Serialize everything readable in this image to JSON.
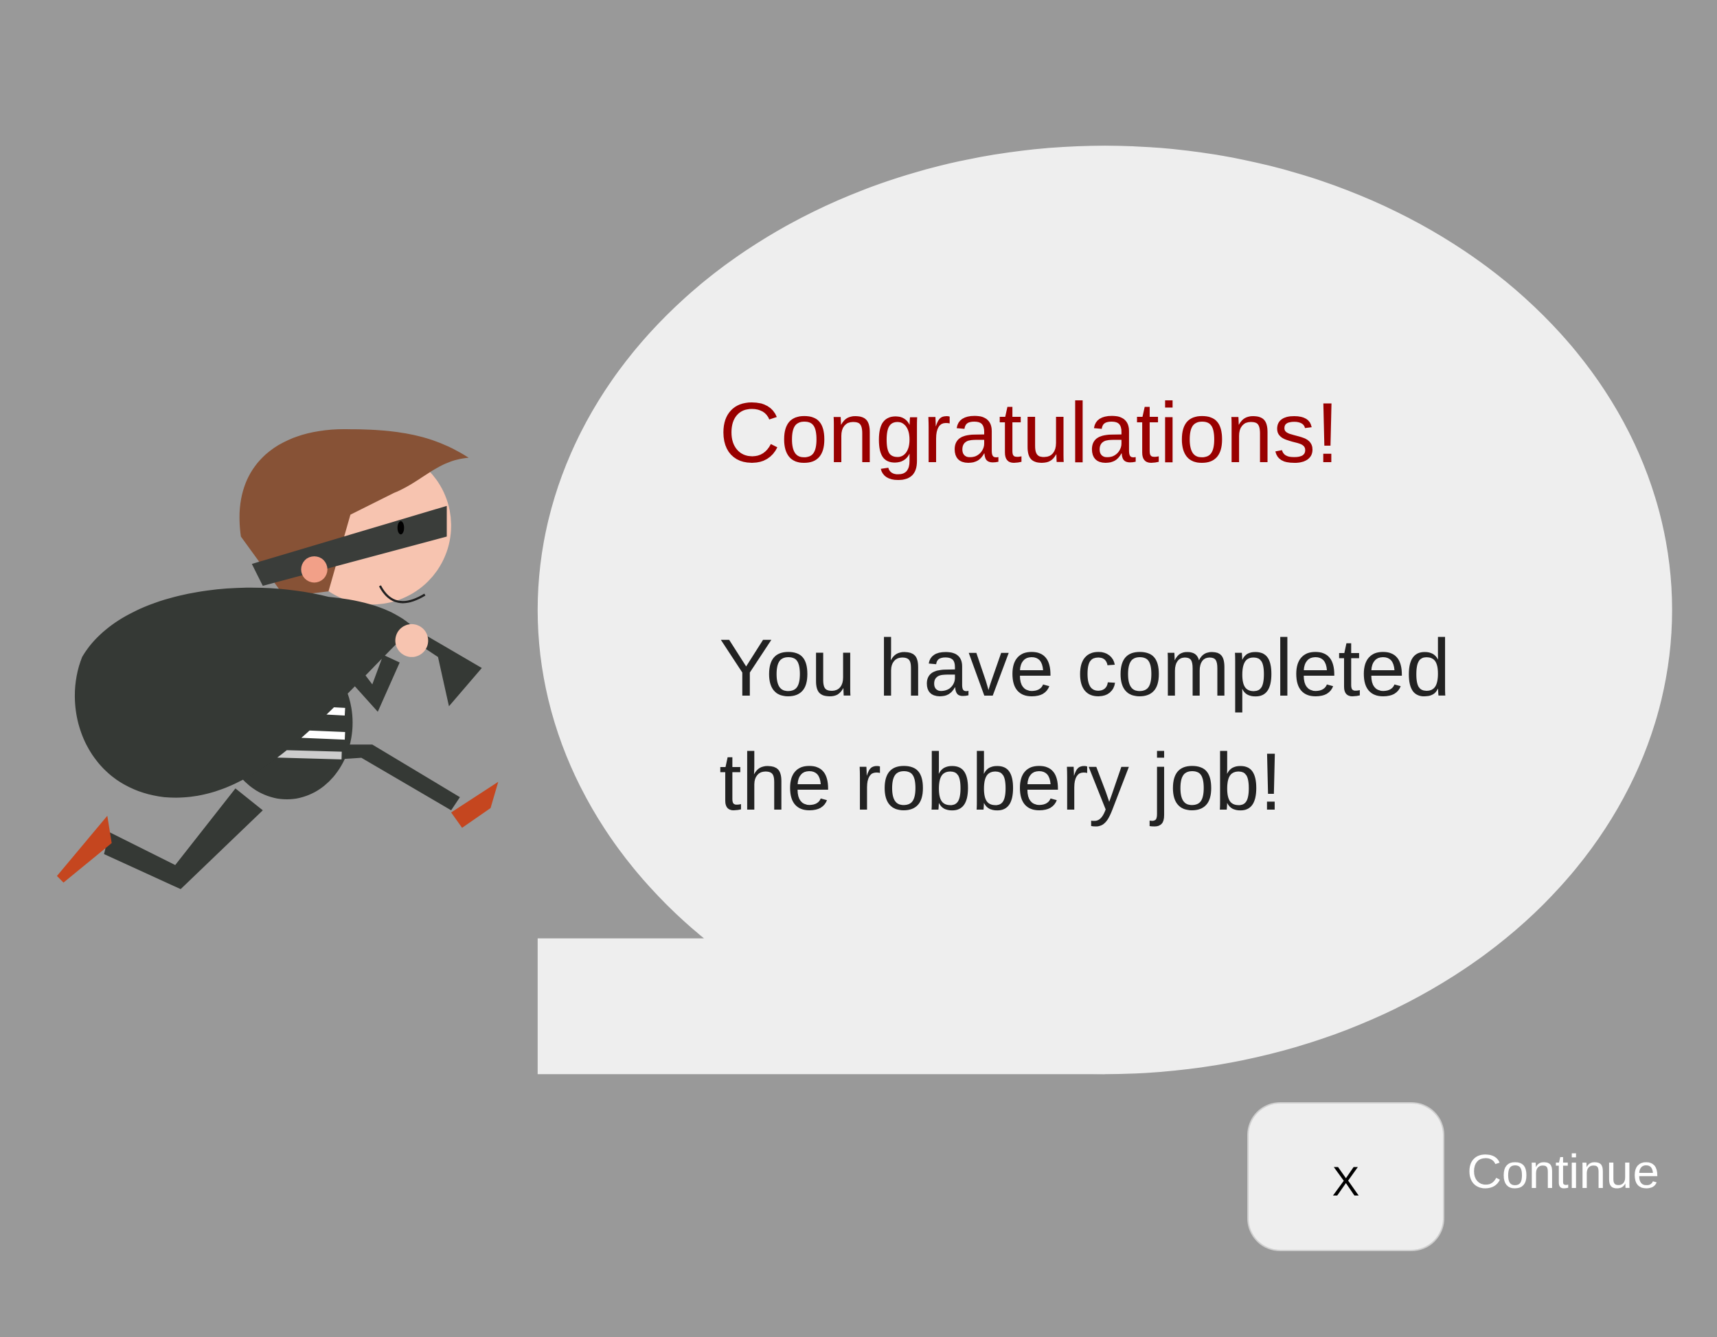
{
  "dialog": {
    "title": "Congratulations!",
    "message_lines": [
      "You have completed",
      "the robbery job!"
    ]
  },
  "close_button": {
    "label": "X"
  },
  "continue_label": "Continue",
  "colors": {
    "background": "#999999",
    "bubble": "#eeeeee",
    "title": "#990000",
    "message": "#222222"
  },
  "illustration": {
    "icon": "running-thief-icon"
  }
}
